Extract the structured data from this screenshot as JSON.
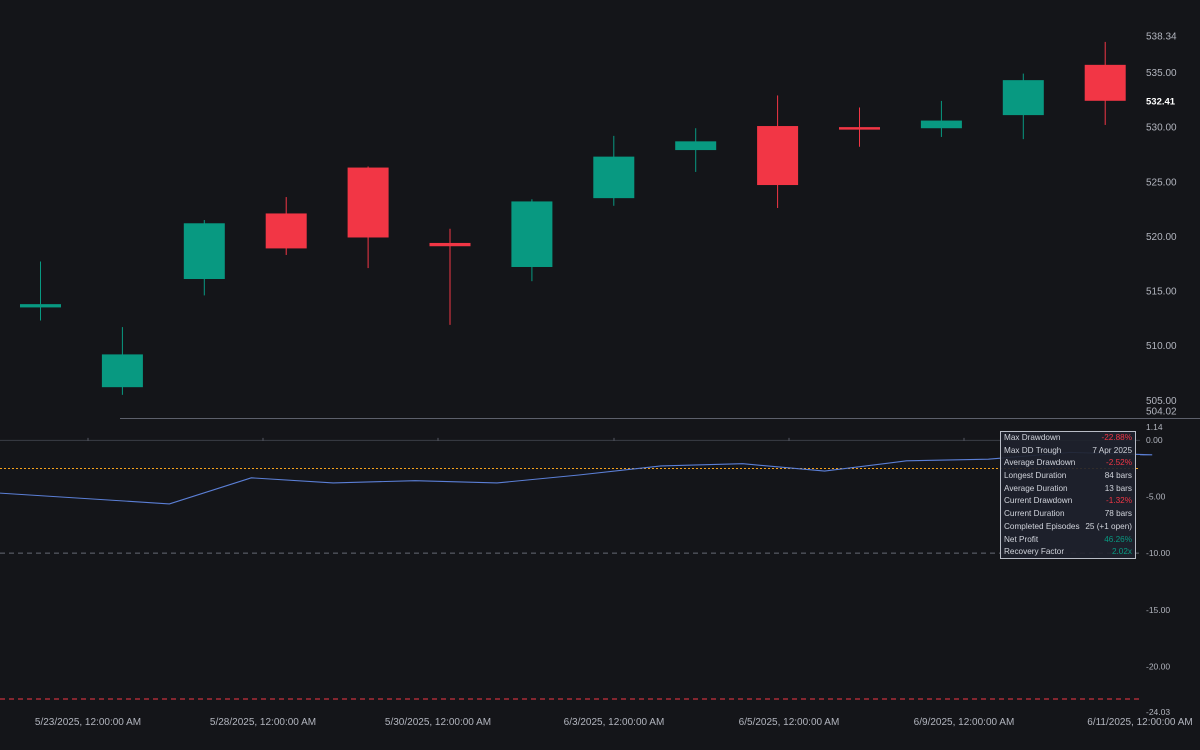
{
  "colors": {
    "background": "#141519",
    "up": "#089981",
    "down": "#f23645",
    "drawdown_line": "#5b7fd6",
    "avg_drawdown_line": "#f7a21b",
    "max_drawdown_line": "#f23645",
    "grid_text": "#b2b5be"
  },
  "chart_data": [
    {
      "type": "candlestick",
      "x": [
        "5/22/2025",
        "5/23/2025",
        "5/27/2025",
        "5/28/2025",
        "5/29/2025",
        "5/30/2025",
        "6/2/2025",
        "6/3/2025",
        "6/4/2025",
        "6/5/2025",
        "6/6/2025",
        "6/9/2025",
        "6/10/2025",
        "6/11/2025"
      ],
      "ohlc": [
        [
          513.5,
          517.7,
          512.3,
          513.8
        ],
        [
          506.2,
          511.7,
          505.5,
          509.2
        ],
        [
          516.1,
          521.5,
          514.6,
          521.2
        ],
        [
          522.1,
          523.6,
          518.3,
          518.9
        ],
        [
          526.3,
          526.4,
          517.1,
          519.9
        ],
        [
          519.4,
          520.7,
          511.9,
          519.1
        ],
        [
          517.2,
          523.4,
          515.9,
          523.2
        ],
        [
          523.5,
          529.2,
          522.8,
          527.3
        ],
        [
          527.9,
          529.9,
          525.9,
          528.7
        ],
        [
          530.1,
          532.9,
          522.6,
          524.7
        ],
        [
          530.0,
          531.8,
          528.2,
          529.8
        ],
        [
          529.9,
          532.4,
          529.1,
          530.6
        ],
        [
          531.1,
          534.9,
          528.9,
          534.3
        ],
        [
          535.7,
          537.8,
          530.2,
          532.41
        ]
      ],
      "ylim": [
        504.02,
        538.34
      ],
      "y_ticks": [
        "538.34",
        "535.00",
        "532.41",
        "530.00",
        "525.00",
        "520.00",
        "515.00",
        "510.00",
        "505.00",
        "504.02"
      ],
      "last_price": "532.41"
    },
    {
      "type": "line",
      "name": "Drawdown",
      "x": [
        "5/22/2025",
        "5/23/2025",
        "5/27/2025",
        "5/28/2025",
        "5/29/2025",
        "5/30/2025",
        "6/2/2025",
        "6/3/2025",
        "6/4/2025",
        "6/5/2025",
        "6/6/2025",
        "6/9/2025",
        "6/10/2025",
        "6/11/2025"
      ],
      "y": [
        -4.7,
        -5.65,
        -3.35,
        -3.8,
        -3.6,
        -3.8,
        -3.1,
        -2.3,
        -2.1,
        -2.75,
        -1.85,
        -1.7,
        -1.1,
        -1.32
      ],
      "ylim": [
        -24.03,
        1.14
      ],
      "y_ticks": [
        "1.14",
        "0.00",
        "-5.00",
        "-10.00",
        "-15.00",
        "-20.00",
        "-24.03"
      ],
      "reference_lines": [
        {
          "label": "Average Drawdown",
          "value": -2.52
        },
        {
          "value": -10.0
        },
        {
          "label": "Max Drawdown",
          "value": -22.88
        }
      ]
    }
  ],
  "x_axis_labels": [
    {
      "x": "5/23/2025",
      "label": "5/23/2025, 12:00:00 AM"
    },
    {
      "x": "5/28/2025",
      "label": "5/28/2025, 12:00:00 AM"
    },
    {
      "x": "5/30/2025",
      "label": "5/30/2025, 12:00:00 AM"
    },
    {
      "x": "6/3/2025",
      "label": "6/3/2025, 12:00:00 AM"
    },
    {
      "x": "6/5/2025",
      "label": "6/5/2025, 12:00:00 AM"
    },
    {
      "x": "6/9/2025",
      "label": "6/9/2025, 12:00:00 AM"
    },
    {
      "x": "6/11/2025",
      "label": "6/11/2025, 12:00:00 AM"
    }
  ],
  "stats": [
    {
      "label": "Max Drawdown",
      "value": "-22.88%",
      "tone": "neg"
    },
    {
      "label": "Max DD Trough",
      "value": "7 Apr 2025",
      "tone": ""
    },
    {
      "label": "Average Drawdown",
      "value": "-2.52%",
      "tone": "neg"
    },
    {
      "label": "Longest Duration",
      "value": "84 bars",
      "tone": ""
    },
    {
      "label": "Average Duration",
      "value": "13 bars",
      "tone": ""
    },
    {
      "label": "Current Drawdown",
      "value": "-1.32%",
      "tone": "neg"
    },
    {
      "label": "Current Duration",
      "value": "78 bars",
      "tone": ""
    },
    {
      "label": "Completed Episodes",
      "value": "25 (+1 open)",
      "tone": ""
    },
    {
      "label": "Net Profit",
      "value": "46.26%",
      "tone": "pos"
    },
    {
      "label": "Recovery Factor",
      "value": "2.02x",
      "tone": "pos"
    }
  ]
}
